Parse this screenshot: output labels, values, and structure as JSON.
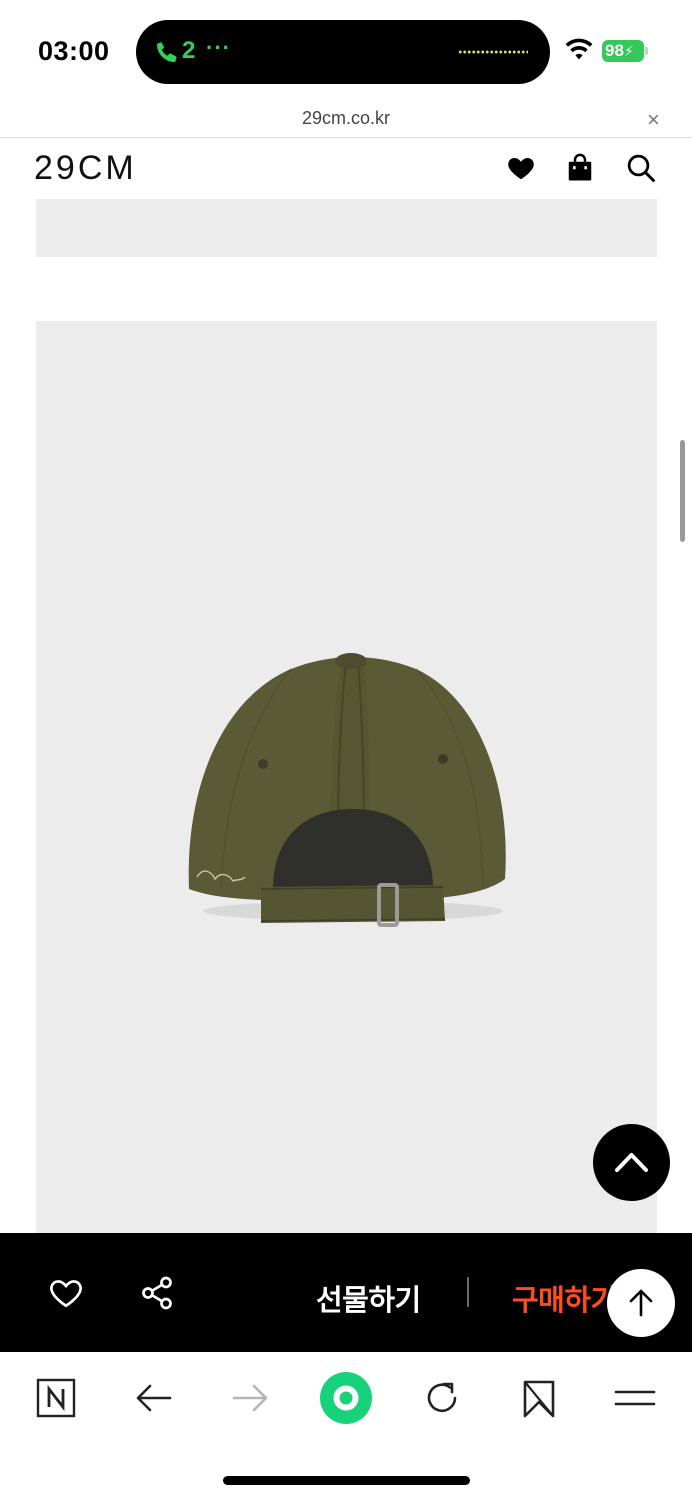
{
  "status_bar": {
    "time": "03:00",
    "call_label": "2",
    "call_more": "···",
    "battery": "98"
  },
  "url_bar": {
    "domain": "29cm.co.kr",
    "close_glyph": "×"
  },
  "header": {
    "logo": "29CM",
    "icons": [
      "heart-icon",
      "shopping-bag-icon",
      "search-icon"
    ]
  },
  "product": {
    "image": "olive green baseball cap, back view"
  },
  "action_bar": {
    "gift_label": "선물하기",
    "buy_label": "구매하기"
  },
  "toolbar": {
    "icons": [
      "naver-n-icon",
      "back-arrow-icon",
      "forward-arrow-icon",
      "home-circle-icon",
      "refresh-icon",
      "bookmark-icon",
      "menu-icon"
    ]
  },
  "colors": {
    "accent_buy": "#ff4e1a",
    "call_green": "#35d05a",
    "battery_green": "#34c759",
    "naver_green": "#17d27a",
    "image_bg": "#ececec",
    "cap_olive": "#5b5a36"
  }
}
